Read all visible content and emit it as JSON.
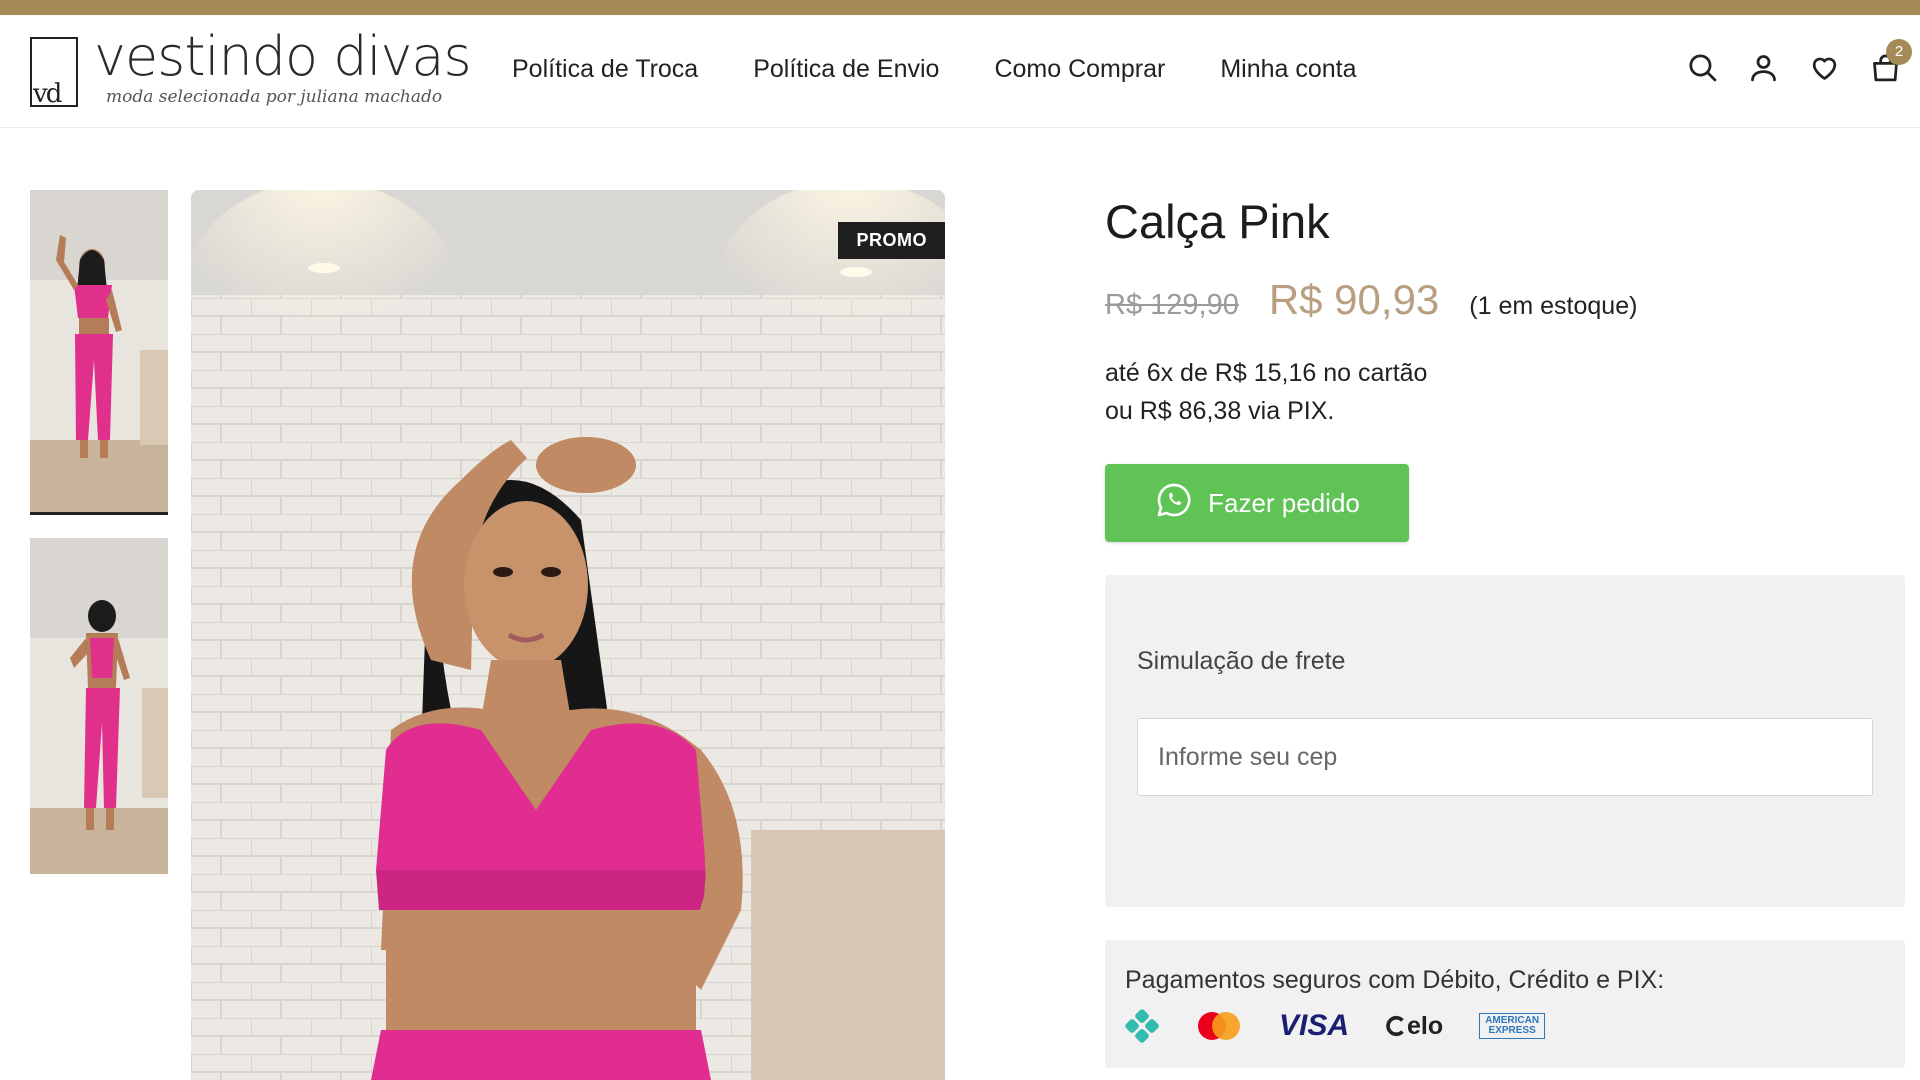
{
  "brand": {
    "logo_mark": "vd",
    "name": "vestindo divas",
    "tagline": "moda selecionada por juliana machado",
    "color_primary": "#a48a57"
  },
  "nav": {
    "items": [
      {
        "label": "Política de Troca"
      },
      {
        "label": "Política de Envio"
      },
      {
        "label": "Como Comprar"
      },
      {
        "label": "Minha conta"
      }
    ]
  },
  "header_icons": {
    "search": "search-icon",
    "account": "user-icon",
    "wishlist": "heart-icon",
    "cart": "shopping-bag-icon",
    "cart_count": "2"
  },
  "gallery": {
    "badge": "PROMO"
  },
  "product": {
    "title": "Calça Pink",
    "old_price": "R$ 129,90",
    "price": "R$ 90,93",
    "stock": "(1 em estoque)",
    "installments": "até 6x de R$ 15,16 no cartão",
    "pix": "ou R$ 86,38 via PIX.",
    "price_color": "#b89f80",
    "order_button": "Fazer pedido",
    "order_button_color": "#5fc356"
  },
  "shipping": {
    "title": "Simulação de frete",
    "placeholder": "Informe seu cep",
    "value": ""
  },
  "payments": {
    "title": "Pagamentos seguros com Débito, Crédito e PIX:",
    "methods": [
      {
        "icon": "pix-icon"
      },
      {
        "icon": "mastercard-icon"
      },
      {
        "icon": "visa-icon",
        "label": "VISA"
      },
      {
        "icon": "elo-icon",
        "label": "elo"
      },
      {
        "icon": "amex-icon",
        "label": "AMERICAN EXPRESS"
      }
    ]
  }
}
